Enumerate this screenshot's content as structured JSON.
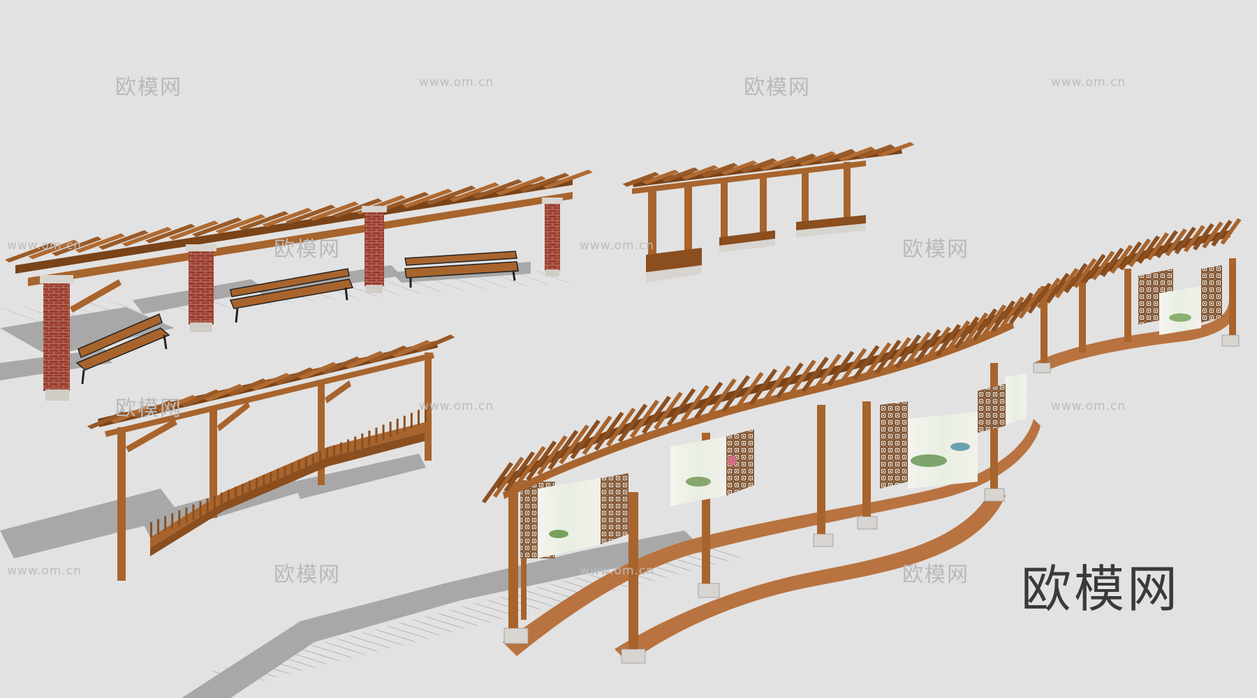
{
  "watermark": {
    "brand": "欧模网",
    "url": "www.om.cn"
  },
  "logo": {
    "text": "欧模网"
  },
  "colors": {
    "background": "#e2e2e2",
    "shadow": "#9c9c9c",
    "wood": "#a8642d",
    "wood_dark": "#7a4318",
    "wood_light": "#c48650",
    "brick": "#9b3b2c",
    "concrete": "#d8d4cf",
    "painting": "#e9efe4",
    "bench_iron": "#222222"
  }
}
